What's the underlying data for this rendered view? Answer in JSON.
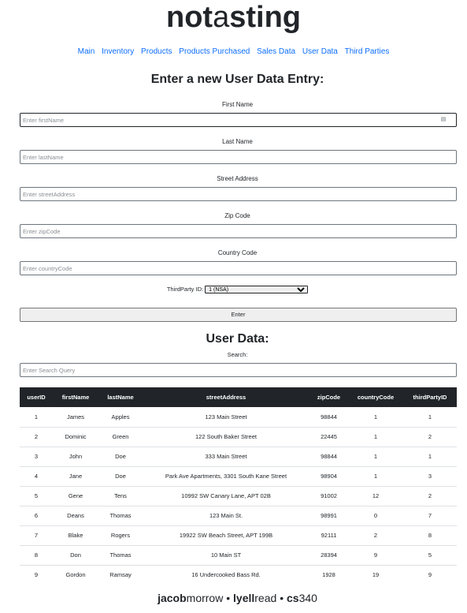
{
  "logo": {
    "bold1": "not",
    "light": "a",
    "bold2": "sting"
  },
  "nav": [
    "Main",
    "Inventory",
    "Products",
    "Products Purchased",
    "Sales Data",
    "User Data",
    "Third Parties"
  ],
  "form": {
    "heading": "Enter a new User Data Entry:",
    "fields": [
      {
        "label": "First Name",
        "placeholder": "Enter firstName"
      },
      {
        "label": "Last Name",
        "placeholder": "Enter lastName"
      },
      {
        "label": "Street Address",
        "placeholder": "Enter streetAddress"
      },
      {
        "label": "Zip Code",
        "placeholder": "Enter zipCode"
      },
      {
        "label": "Country Code",
        "placeholder": "Enter countryCode"
      }
    ],
    "third_party_label": "ThirdParty ID:",
    "third_party_value": "1 (NSA)",
    "enter_label": "Enter"
  },
  "data_section": {
    "heading": "User Data:",
    "search_label": "Search:",
    "search_placeholder": "Enter Search Query"
  },
  "table": {
    "columns": [
      "userID",
      "firstName",
      "lastName",
      "streetAddress",
      "zipCode",
      "countryCode",
      "thirdPartyID"
    ],
    "rows": [
      [
        "1",
        "James",
        "Apples",
        "123 Main Street",
        "98844",
        "1",
        "1"
      ],
      [
        "2",
        "Dominic",
        "Green",
        "122 South Baker Street",
        "22445",
        "1",
        "2"
      ],
      [
        "3",
        "John",
        "Doe",
        "333 Main Street",
        "98844",
        "1",
        "1"
      ],
      [
        "4",
        "Jane",
        "Doe",
        "Park Ave Apartments, 3301 South Kane Street",
        "98904",
        "1",
        "3"
      ],
      [
        "5",
        "Gene",
        "Tens",
        "10992 SW Canary Lane, APT 02B",
        "91002",
        "12",
        "2"
      ],
      [
        "6",
        "Deans",
        "Thomas",
        "123 Main St.",
        "98991",
        "0",
        "7"
      ],
      [
        "7",
        "Blake",
        "Rogers",
        "19922 SW Beach Street, APT 199B",
        "92111",
        "2",
        "8"
      ],
      [
        "8",
        "Don",
        "Thomas",
        "10 Main ST",
        "28394",
        "9",
        "5"
      ],
      [
        "9",
        "Gordon",
        "Ramsay",
        "16 Undercooked Bass Rd.",
        "1928",
        "19",
        "9"
      ]
    ]
  },
  "footer": {
    "a_bold": "jacob",
    "a_light": "morrow",
    "sep": "•",
    "b_bold": "lyell",
    "b_light": "read",
    "c_bold": "cs",
    "c_light": "340"
  }
}
